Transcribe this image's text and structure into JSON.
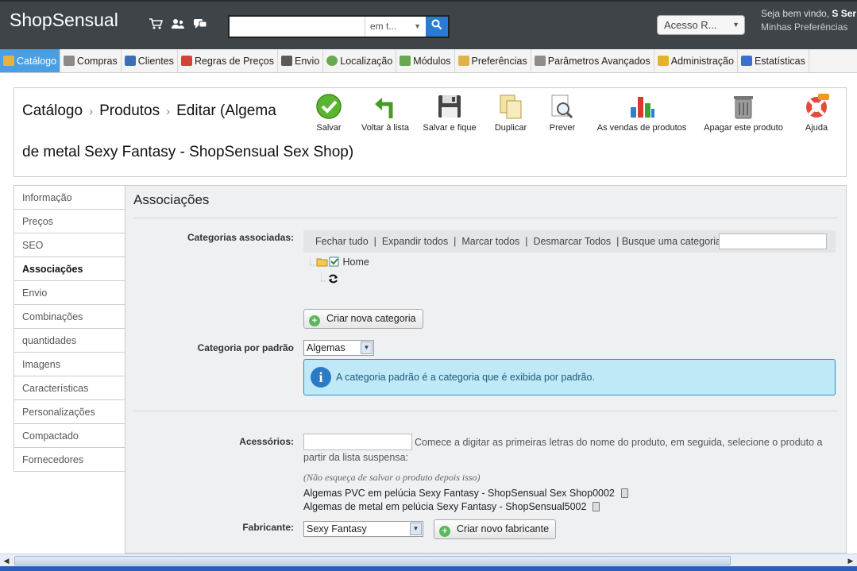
{
  "header": {
    "logo": "ShopSensual",
    "search_placeholder": "",
    "search_scope": "em t...",
    "quick_access": "Acesso R...",
    "welcome_prefix": "Seja bem vindo,",
    "welcome_user": "S Ser",
    "preferences_link": "Minhas Preferências"
  },
  "tabs": [
    {
      "label": "Catálogo",
      "color": "#e8b33a"
    },
    {
      "label": "Compras",
      "color": "#8a8a8a"
    },
    {
      "label": "Clientes",
      "color": "#3c6fb4"
    },
    {
      "label": "Regras de Preços",
      "color": "#d2443a"
    },
    {
      "label": "Envio",
      "color": "#5a5a5a"
    },
    {
      "label": "Localização",
      "color": "#6aa84f"
    },
    {
      "label": "Módulos",
      "color": "#6aa84f"
    },
    {
      "label": "Preferências",
      "color": "#e0b34a"
    },
    {
      "label": "Parâmetros Avançados",
      "color": "#8c8c8c"
    },
    {
      "label": "Administração",
      "color": "#e3b32a"
    },
    {
      "label": "Estatísticas",
      "color": "#3d6fd0"
    }
  ],
  "toolbar": {
    "breadcrumb": [
      "Catálogo",
      "Produtos",
      "Editar (Algema"
    ],
    "title_line2": "de metal Sexy Fantasy - ShopSensual Sex Shop)",
    "buttons": {
      "save": "Salvar",
      "back": "Voltar à lista",
      "save_stay": "Salvar e fique",
      "duplicate": "Duplicar",
      "preview": "Prever",
      "sales": "As vendas de produtos",
      "delete": "Apagar este produto",
      "help": "Ajuda"
    }
  },
  "sidemenu": [
    "Informação",
    "Preços",
    "SEO",
    "Associações",
    "Envio",
    "Combinações",
    "quantidades",
    "Imagens",
    "Características",
    "Personalizações",
    "Compactado",
    "Fornecedores"
  ],
  "sidemenu_active": "Associações",
  "panel": {
    "title": "Associações",
    "categories_label": "Categorias associadas:",
    "tree_toolbar": "Fechar tudo  |  Expandir todos  |  Marcar todos  |  Desmarcar Todos  | Busque uma categoria:",
    "tree_home": "Home",
    "create_category": "Criar nova categoria",
    "default_category_label": "Categoria por padrão",
    "default_category_value": "Algemas",
    "info_text": "A categoria padrão é a categoria que é exibida por padrão.",
    "accessories_label": "Acessórios:",
    "accessories_hint": "Comece a digitar as primeiras letras do nome do produto, em seguida, selecione o produto a partir da lista suspensa:",
    "accessories_note": "(Não esqueça de salvar o produto depois isso)",
    "accessories": [
      "Algemas PVC em pelúcia Sexy Fantasy - ShopSensual Sex Shop0002",
      "Algemas de metal em pelúcia Sexy Fantasy - ShopSensual5002"
    ],
    "manufacturer_label": "Fabricante:",
    "manufacturer_value": "Sexy Fantasy",
    "create_manufacturer": "Criar novo fabricante"
  }
}
